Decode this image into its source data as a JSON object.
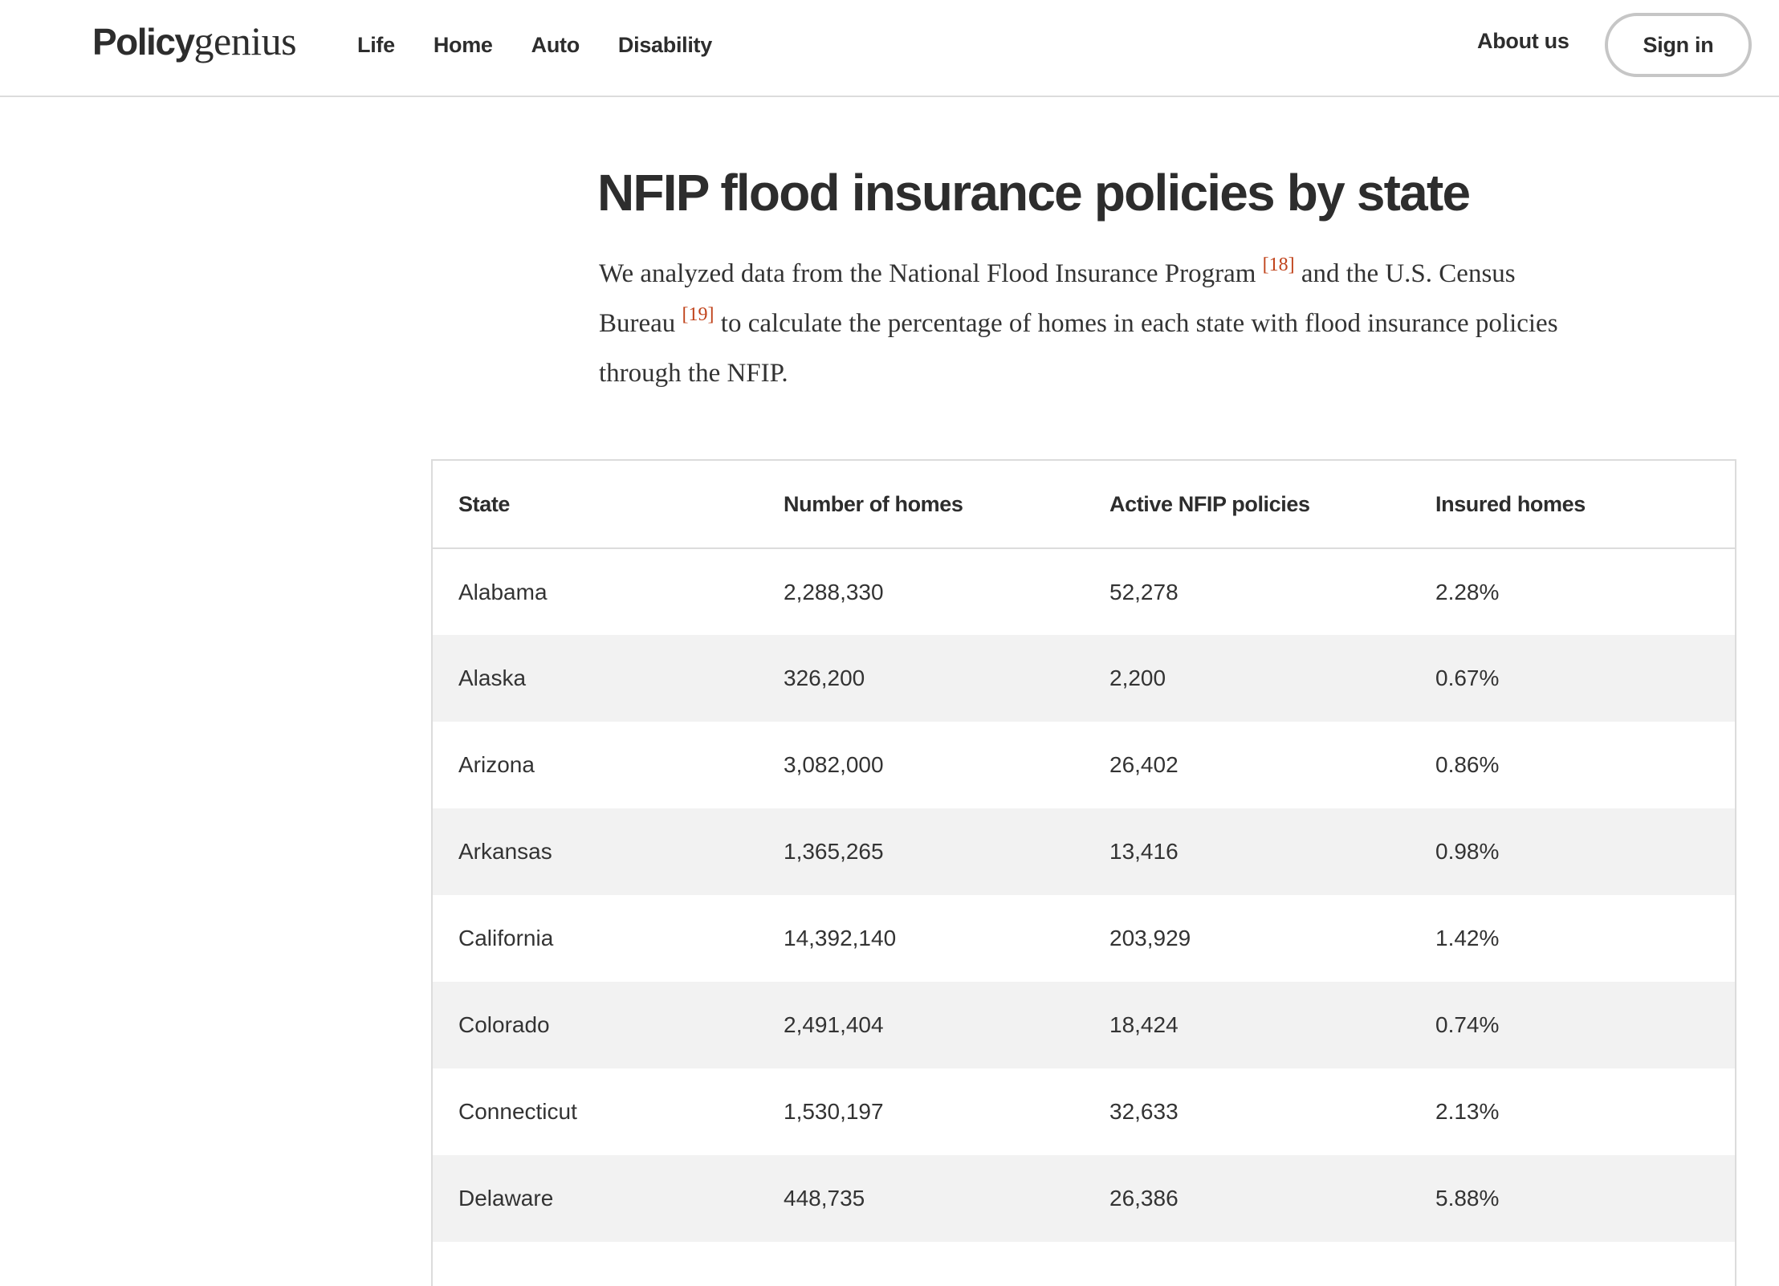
{
  "header": {
    "logo_bold": "Policy",
    "logo_light": "genius",
    "nav": [
      {
        "label": "Life"
      },
      {
        "label": "Home"
      },
      {
        "label": "Auto"
      },
      {
        "label": "Disability"
      }
    ],
    "about_label": "About us",
    "signin_label": "Sign in"
  },
  "article": {
    "title": "NFIP flood insurance policies by state",
    "intro_part1": "We analyzed data from the National Flood Insurance Program ",
    "cite1": "[18]",
    "intro_part2": " and the U.S. Census Bureau ",
    "cite2": "[19]",
    "intro_part3": " to calculate the percentage of homes in each state with flood insurance policies through the NFIP."
  },
  "table": {
    "columns": [
      "State",
      "Number of homes",
      "Active NFIP policies",
      "Insured homes"
    ],
    "rows": [
      [
        "Alabama",
        "2,288,330",
        "52,278",
        "2.28%"
      ],
      [
        "Alaska",
        "326,200",
        "2,200",
        "0.67%"
      ],
      [
        "Arizona",
        "3,082,000",
        "26,402",
        "0.86%"
      ],
      [
        "Arkansas",
        "1,365,265",
        "13,416",
        "0.98%"
      ],
      [
        "California",
        "14,392,140",
        "203,929",
        "1.42%"
      ],
      [
        "Colorado",
        "2,491,404",
        "18,424",
        "0.74%"
      ],
      [
        "Connecticut",
        "1,530,197",
        "32,633",
        "2.13%"
      ],
      [
        "Delaware",
        "448,735",
        "26,386",
        "5.88%"
      ]
    ]
  },
  "colors": {
    "text": "#2d2d2d",
    "citation": "#c0431b",
    "stripe": "#f2f2f2",
    "border": "#dcdcdc"
  }
}
